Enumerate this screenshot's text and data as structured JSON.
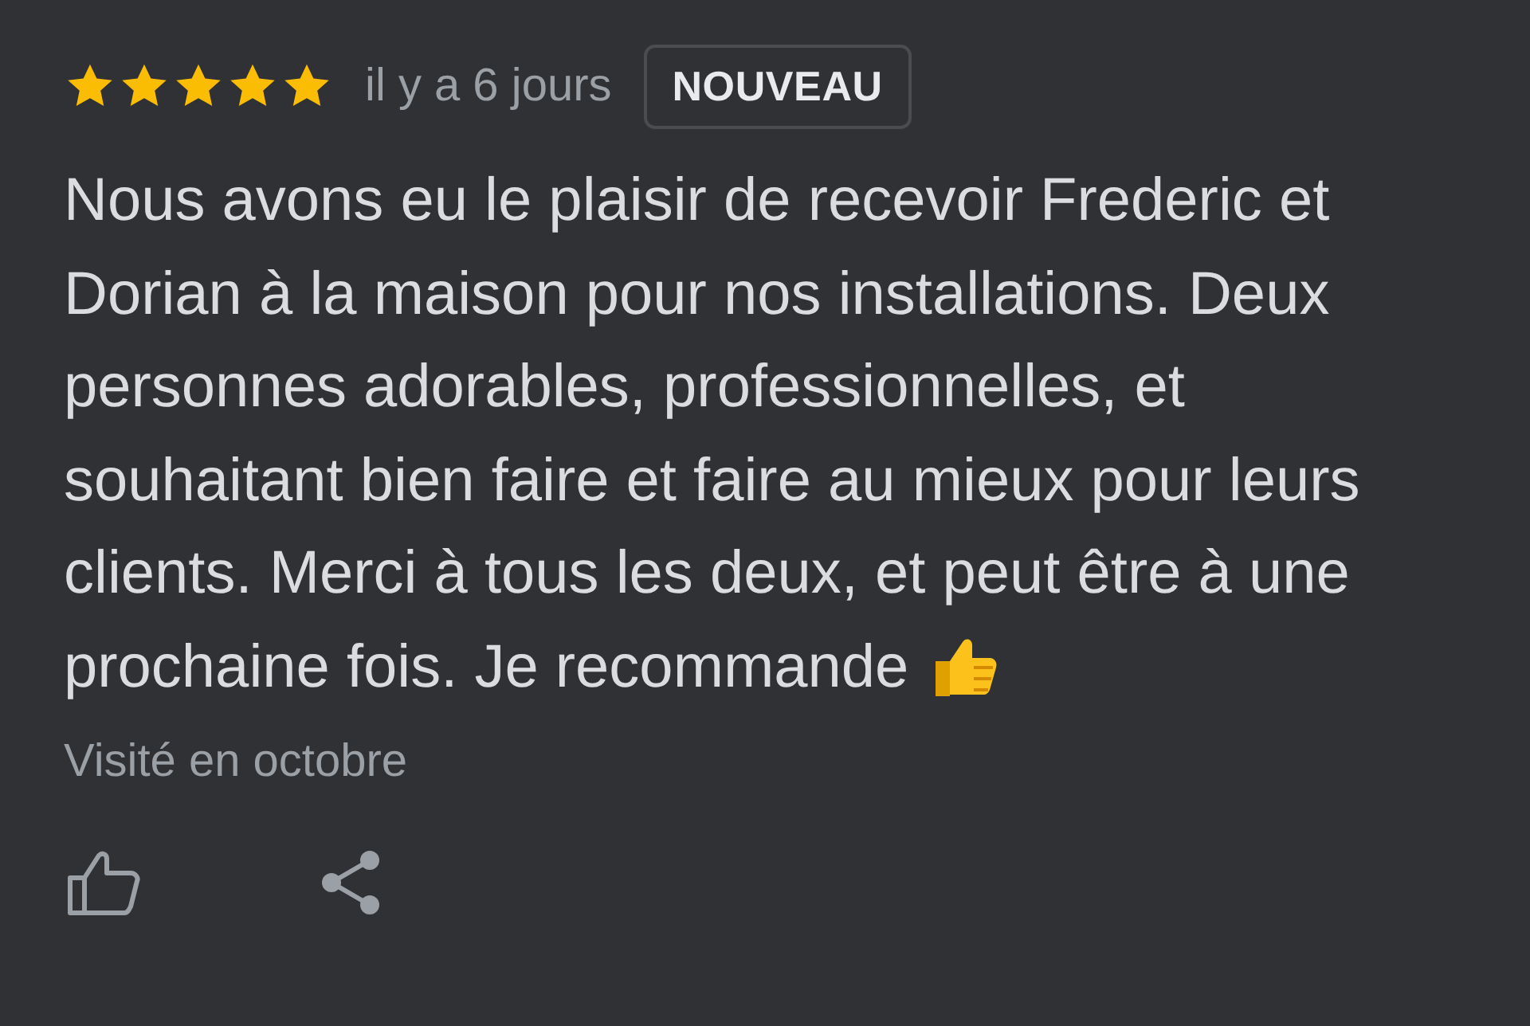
{
  "review": {
    "stars": 5,
    "time": "il y a 6 jours",
    "badge": "NOUVEAU",
    "text": "Nous avons eu le plaisir de recevoir Frederic et Dorian à la maison pour nos installations. Deux personnes adorables, professionnelles, et souhaitant bien faire et faire au mieux pour leurs clients. Merci à tous les deux, et peut être à une prochaine fois. Je recommande",
    "visited": "Visité en octobre"
  }
}
